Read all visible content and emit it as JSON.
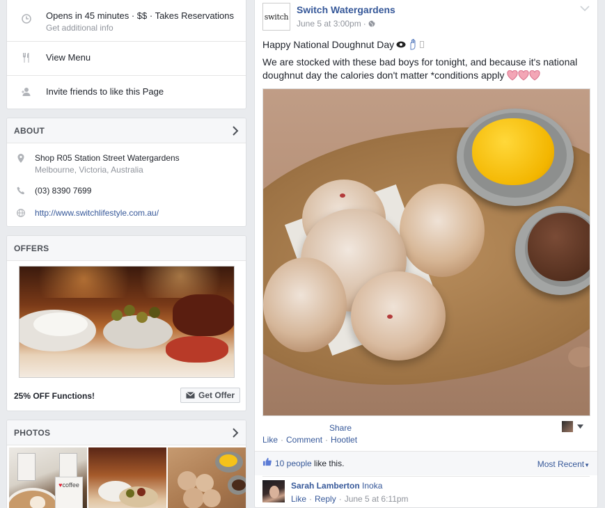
{
  "info": {
    "hours": "Opens in 45 minutes · $$ · Takes Reservations",
    "hours_sub": "Get additional info",
    "menu": "View Menu",
    "invite": "Invite friends to like this Page"
  },
  "about": {
    "title": "ABOUT",
    "address_line1": "Shop R05 Station Street Watergardens",
    "address_line2": "Melbourne, Victoria, Australia",
    "phone": "(03) 8390 7699",
    "website": "http://www.switchlifestyle.com.au/"
  },
  "offers": {
    "title": "OFFERS",
    "offer_text": "25% OFF Functions!",
    "button": "Get Offer"
  },
  "photos": {
    "title": "PHOTOS",
    "cup_text": "coffee"
  },
  "post": {
    "page_name": "Switch Watergardens",
    "avatar_text": "switch",
    "date": "June 5 at 3:00pm",
    "line1": "Happy National Doughnut Day",
    "line2": "We are stocked with these bad boys for tonight, and because it's national doughnut day the calories don't matter *conditions apply",
    "share": "Share",
    "like": "Like",
    "comment": "Comment",
    "hootlet": "Hootlet",
    "likes_text": "10 people like this.",
    "likes_count_link": "10 people",
    "sort": "Most Recent"
  },
  "comment": {
    "author": "Sarah Lamberton",
    "tag": "Inoka",
    "like": "Like",
    "reply": "Reply",
    "time": "June 5 at 6:11pm"
  },
  "colors": {
    "link": "#365899",
    "muted": "#90949c",
    "bg": "#e9ebee",
    "heart": "#f3a6b6"
  }
}
